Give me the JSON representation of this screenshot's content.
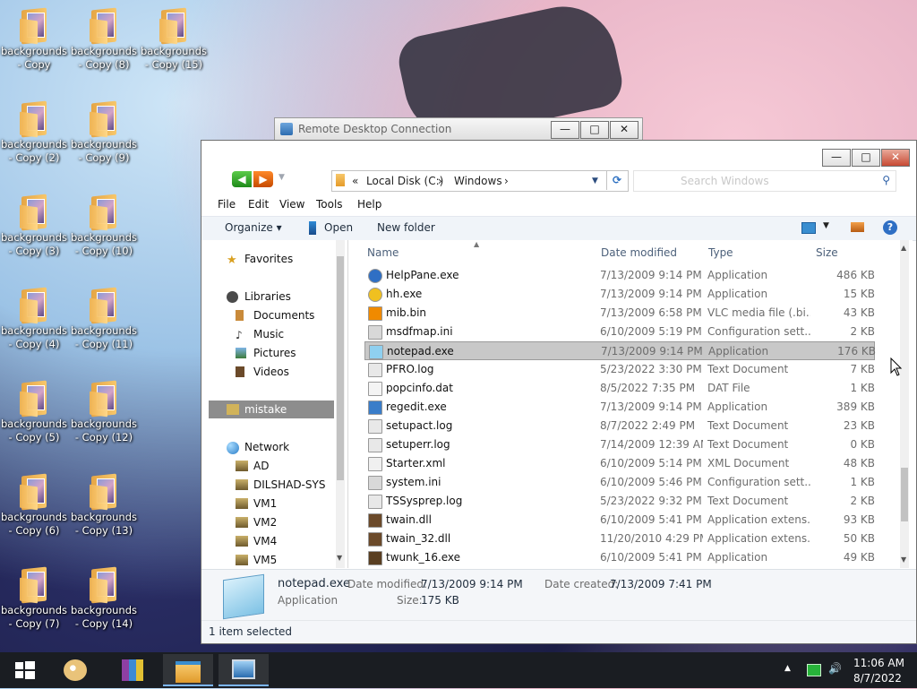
{
  "desktop": {
    "icons": [
      {
        "label": "backgrounds - Copy"
      },
      {
        "label": "backgrounds - Copy (8)"
      },
      {
        "label": "backgrounds - Copy (15)"
      },
      {
        "label": "backgrounds - Copy (2)"
      },
      {
        "label": "backgrounds - Copy (9)"
      },
      {
        "label": "backgrounds - Copy (3)"
      },
      {
        "label": "backgrounds - Copy (10)"
      },
      {
        "label": "backgrounds - Copy (4)"
      },
      {
        "label": "backgrounds - Copy (11)"
      },
      {
        "label": "backgrounds - Copy (5)"
      },
      {
        "label": "backgrounds - Copy (12)"
      },
      {
        "label": "backgrounds - Copy (6)"
      },
      {
        "label": "backgrounds - Copy (13)"
      },
      {
        "label": "backgrounds - Copy (7)"
      },
      {
        "label": "backgrounds - Copy (14)"
      }
    ]
  },
  "rdp_window": {
    "title": "Remote Desktop Connection",
    "minimize": "—",
    "maximize": "□",
    "close": "✕"
  },
  "explorer": {
    "minimize": "—",
    "maximize": "□",
    "close": "✕",
    "address": {
      "overflow": "«",
      "crumbs": [
        "Local Disk (C:)",
        "Windows"
      ],
      "sep": "›"
    },
    "search_placeholder": "Search Windows",
    "menu": [
      "File",
      "Edit",
      "View",
      "Tools",
      "Help"
    ],
    "toolbar": {
      "organize": "Organize ▾",
      "open": "Open",
      "new_folder": "New folder"
    },
    "nav": {
      "favorites": "Favorites",
      "libraries": "Libraries",
      "library_items": [
        "Documents",
        "Music",
        "Pictures",
        "Videos"
      ],
      "selected": "mistake",
      "network": "Network",
      "network_items": [
        "AD",
        "DILSHAD-SYS",
        "VM1",
        "VM2",
        "VM4",
        "VM5"
      ]
    },
    "columns": {
      "name": "Name",
      "date": "Date modified",
      "type": "Type",
      "size": "Size"
    },
    "files": [
      {
        "name": "HelpPane.exe",
        "date": "7/13/2009 9:14 PM",
        "type": "Application",
        "size": "486 KB",
        "icon": "help-icon"
      },
      {
        "name": "hh.exe",
        "date": "7/13/2009 9:14 PM",
        "type": "Application",
        "size": "15 KB",
        "icon": "help-question-icon"
      },
      {
        "name": "mib.bin",
        "date": "7/13/2009 6:58 PM",
        "type": "VLC media file (.bi...",
        "size": "43 KB",
        "icon": "vlc-cone-icon"
      },
      {
        "name": "msdfmap.ini",
        "date": "6/10/2009 5:19 PM",
        "type": "Configuration sett...",
        "size": "2 KB",
        "icon": "config-file-icon"
      },
      {
        "name": "notepad.exe",
        "date": "7/13/2009 9:14 PM",
        "type": "Application",
        "size": "176 KB",
        "icon": "notepad-icon"
      },
      {
        "name": "PFRO.log",
        "date": "5/23/2022 3:30 PM",
        "type": "Text Document",
        "size": "7 KB",
        "icon": "text-file-icon"
      },
      {
        "name": "popcinfo.dat",
        "date": "8/5/2022 7:35 PM",
        "type": "DAT File",
        "size": "1 KB",
        "icon": "file-icon"
      },
      {
        "name": "regedit.exe",
        "date": "7/13/2009 9:14 PM",
        "type": "Application",
        "size": "389 KB",
        "icon": "regedit-icon"
      },
      {
        "name": "setupact.log",
        "date": "8/7/2022 2:49 PM",
        "type": "Text Document",
        "size": "23 KB",
        "icon": "text-file-icon"
      },
      {
        "name": "setuperr.log",
        "date": "7/14/2009 12:39 AM",
        "type": "Text Document",
        "size": "0 KB",
        "icon": "text-file-icon"
      },
      {
        "name": "Starter.xml",
        "date": "6/10/2009 5:14 PM",
        "type": "XML Document",
        "size": "48 KB",
        "icon": "xml-file-icon"
      },
      {
        "name": "system.ini",
        "date": "6/10/2009 5:46 PM",
        "type": "Configuration sett...",
        "size": "1 KB",
        "icon": "config-file-icon"
      },
      {
        "name": "TSSysprep.log",
        "date": "5/23/2022 9:32 PM",
        "type": "Text Document",
        "size": "2 KB",
        "icon": "text-file-icon"
      },
      {
        "name": "twain.dll",
        "date": "6/10/2009 5:41 PM",
        "type": "Application extens...",
        "size": "93 KB",
        "icon": "dll-icon"
      },
      {
        "name": "twain_32.dll",
        "date": "11/20/2010 4:29 PM",
        "type": "Application extens...",
        "size": "50 KB",
        "icon": "dll-icon"
      },
      {
        "name": "twunk_16.exe",
        "date": "6/10/2009 5:41 PM",
        "type": "Application",
        "size": "49 KB",
        "icon": "app-icon"
      }
    ],
    "selected_file": "notepad.exe",
    "details": {
      "name": "notepad.exe",
      "kind": "Application",
      "modified_label": "Date modified:",
      "modified_value": "7/13/2009 9:14 PM",
      "created_label": "Date created:",
      "created_value": "7/13/2009 7:41 PM",
      "size_label": "Size:",
      "size_value": "175 KB"
    },
    "status": "1 item selected"
  },
  "taskbar": {
    "time": "11:06 AM",
    "date": "8/7/2022",
    "tray_up": "▲",
    "items": [
      "start-icon",
      "paint-icon",
      "winrar-icon",
      "file-explorer-icon",
      "remote-desktop-icon"
    ]
  }
}
